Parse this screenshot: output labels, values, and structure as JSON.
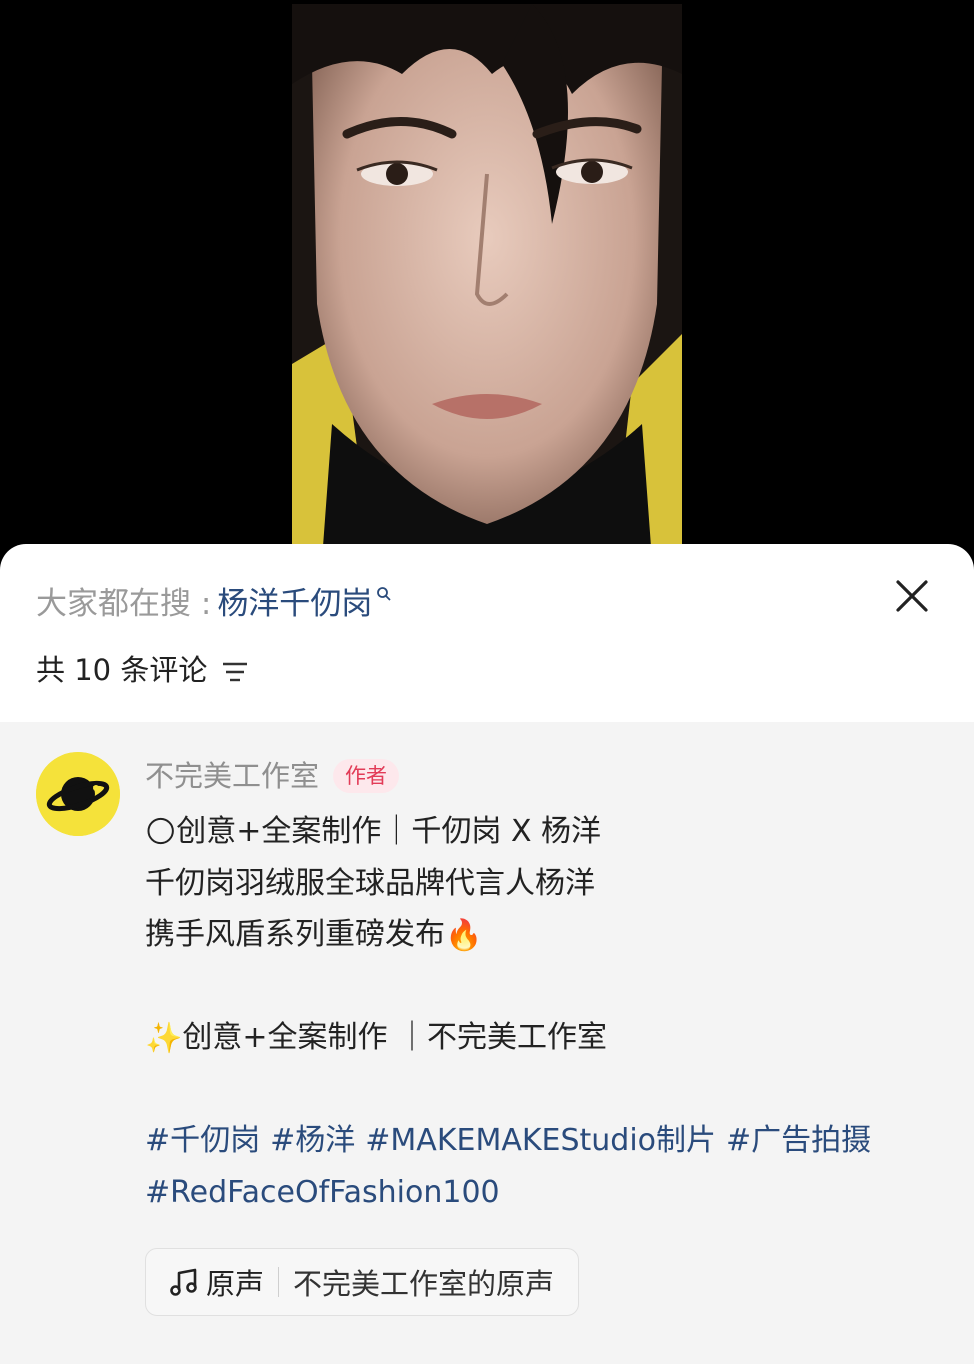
{
  "search": {
    "prefix": "大家都在搜 :",
    "term": "杨洋千仞岗"
  },
  "comments": {
    "count_label": "共 10 条评论"
  },
  "comment": {
    "author": "不完美工作室",
    "badge": "作者",
    "line1_emoji": "🌕",
    "line1_text": "创意+全案制作｜千仞岗 X 杨洋",
    "line2_text": "千仞岗羽绒服全球品牌代言人杨洋",
    "line3_text": "携手风盾系列重磅发布",
    "line3_emoji": "🔥",
    "line5_emoji": "✨",
    "line5_text": "创意+全案制作 ｜不完美工作室",
    "tags": [
      "#千仞岗",
      "#杨洋",
      "#MAKEMAKEStudio制片",
      "#广告拍摄",
      "#RedFaceOfFashion100"
    ]
  },
  "audio": {
    "label": "原声",
    "title": "不完美工作室的原声"
  },
  "colors": {
    "accent_link": "#2a4b7c",
    "badge_bg": "#fde8ec",
    "badge_text": "#e23b57",
    "avatar_bg": "#f5e23a"
  },
  "icons": [
    "search-icon",
    "close-icon",
    "sort-icon",
    "planet-logo-icon",
    "music-note-icon"
  ]
}
